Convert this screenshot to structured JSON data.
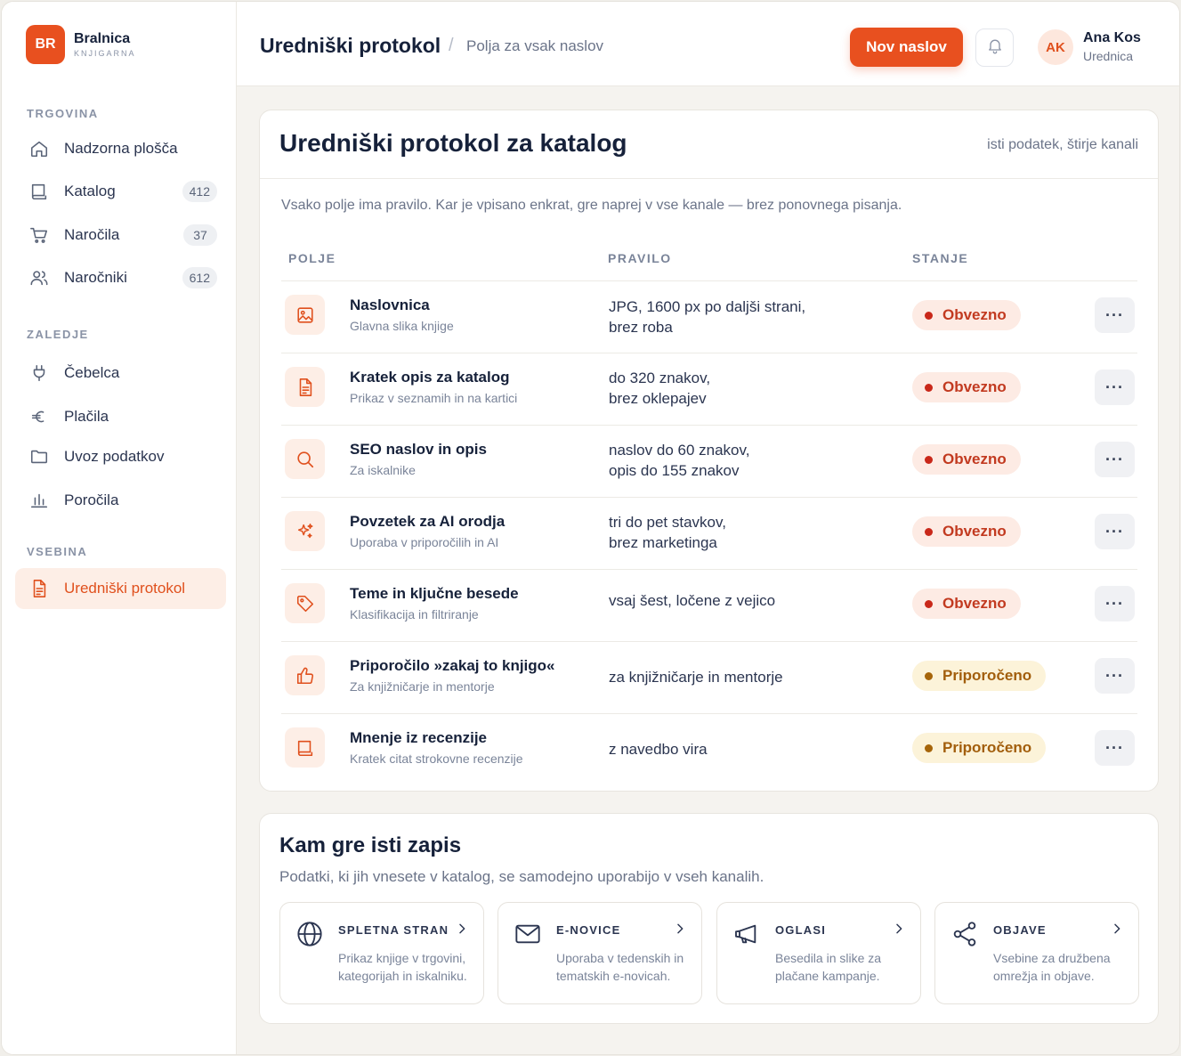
{
  "brand": {
    "initials": "BR",
    "name": "Bralnica",
    "subtitle": "KNJIGARNA",
    "accent": "#e8501f"
  },
  "sidebar": {
    "sections": [
      {
        "label": "TRGOVINA"
      },
      {
        "label": "ZALEDJE"
      },
      {
        "label": "VSEBINA"
      }
    ],
    "items": [
      {
        "label": "Nadzorna plošča",
        "icon": "home-icon"
      },
      {
        "label": "Katalog",
        "count": "412",
        "icon": "book-icon"
      },
      {
        "label": "Naročila",
        "count": "37",
        "icon": "cart-icon"
      },
      {
        "label": "Naročniki",
        "count": "612",
        "icon": "users-icon"
      },
      {
        "label": "Čebelca",
        "icon": "plug-icon"
      },
      {
        "label": "Plačila",
        "icon": "euro-icon"
      },
      {
        "label": "Uvoz podatkov",
        "icon": "folder-icon"
      },
      {
        "label": "Poročila",
        "icon": "bar-chart-icon"
      },
      {
        "label": "Uredniški protokol",
        "icon": "document-icon",
        "active": true
      }
    ]
  },
  "header": {
    "title": "Uredniški protokol",
    "separator": "/",
    "subtitle": "Polja za vsak naslov",
    "new_button": "Nov naslov",
    "user": {
      "initials": "AK",
      "name": "Ana Kos",
      "role": "Urednica"
    }
  },
  "protocol": {
    "title": "Uredniški protokol za katalog",
    "aside": "isti podatek, štirje kanali",
    "description": "Vsako polje ima pravilo. Kar je vpisano enkrat, gre naprej v vse kanale — brez ponovnega pisanja.",
    "columns": [
      "POLJE",
      "PRAVILO",
      "STANJE"
    ],
    "rows": [
      {
        "name": "Naslovnica",
        "sub": "Glavna slika knjige",
        "rule": [
          "JPG, 1600 px po daljši strani,",
          "brez roba"
        ],
        "status": "Obvezno",
        "kind": "req",
        "icon": "image-icon"
      },
      {
        "name": "Kratek opis za katalog",
        "sub": "Prikaz v seznamih in na kartici",
        "rule": [
          "do 320 znakov,",
          "brez oklepajev"
        ],
        "status": "Obvezno",
        "kind": "req",
        "icon": "file-text-icon"
      },
      {
        "name": "SEO naslov in opis",
        "sub": "Za iskalnike",
        "rule": [
          "naslov do 60 znakov,",
          "opis do 155 znakov"
        ],
        "status": "Obvezno",
        "kind": "req",
        "icon": "search-icon"
      },
      {
        "name": "Povzetek za AI orodja",
        "sub": "Uporaba v priporočilih in AI",
        "rule": [
          "tri do pet stavkov,",
          "brez marketinga"
        ],
        "status": "Obvezno",
        "kind": "req",
        "icon": "sparkles-icon"
      },
      {
        "name": "Teme in ključne besede",
        "sub": "Klasifikacija in filtriranje",
        "rule": [
          "vsaj šest, ločene z vejico"
        ],
        "status": "Obvezno",
        "kind": "req",
        "icon": "tag-icon"
      },
      {
        "name": "Priporočilo »zakaj to knjigo«",
        "sub": "Za knjižničarje in mentorje",
        "rule": [
          "za knjižničarje in mentorje"
        ],
        "status": "Priporočeno",
        "kind": "rec",
        "icon": "thumbs-up-icon"
      },
      {
        "name": "Mnenje iz recenzije",
        "sub": "Kratek citat strokovne recenzije",
        "rule": [
          "z navedbo vira"
        ],
        "status": "Priporočeno",
        "kind": "rec",
        "icon": "book-open-icon"
      }
    ],
    "more_label": "···"
  },
  "channels": {
    "title": "Kam gre isti zapis",
    "description": "Podatki, ki jih vnesete v katalog, se samodejno uporabijo v vseh kanalih.",
    "items": [
      {
        "name": "SPLETNA STRAN",
        "desc": "Prikaz knjige v trgovini, kategorijah in iskalniku.",
        "icon": "globe-icon"
      },
      {
        "name": "E-NOVICE",
        "desc": "Uporaba v tedenskih in tematskih e-novicah.",
        "icon": "mail-icon"
      },
      {
        "name": "OGLASI",
        "desc": "Besedila in slike za plačane kampanje.",
        "icon": "megaphone-icon"
      },
      {
        "name": "OBJAVE",
        "desc": "Vsebine za družbena omrežja in objave.",
        "icon": "share-icon"
      }
    ]
  },
  "colors": {
    "required": "#c9281a",
    "recommended": "#a6650a",
    "accent": "#e8501f"
  }
}
